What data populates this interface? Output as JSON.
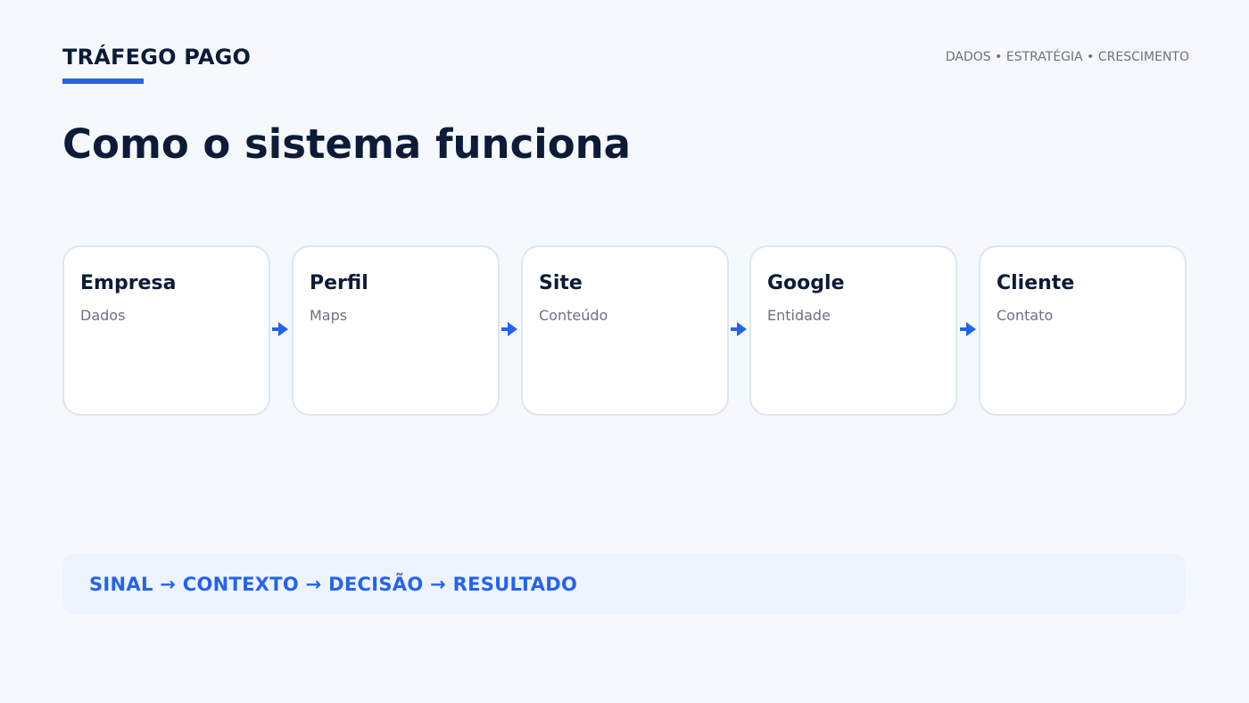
{
  "header": {
    "brand": "TRÁFEGO PAGO",
    "tagline": "DADOS • ESTRATÉGIA • CRESCIMENTO"
  },
  "title": "Como o sistema funciona",
  "flow": {
    "steps": [
      {
        "title": "Empresa",
        "subtitle": "Dados"
      },
      {
        "title": "Perfil",
        "subtitle": "Maps"
      },
      {
        "title": "Site",
        "subtitle": "Conteúdo"
      },
      {
        "title": "Google",
        "subtitle": "Entidade"
      },
      {
        "title": "Cliente",
        "subtitle": "Contato"
      }
    ],
    "connector_icon": "arrow-right-icon"
  },
  "footer": {
    "sequence": "SINAL → CONTEXTO → DECISÃO → RESULTADO"
  },
  "colors": {
    "accent": "#2563eb",
    "heading": "#0d1b38",
    "muted": "#6b7280",
    "background": "#f5f9fd",
    "card_border": "#dde6f0",
    "footer_background": "#edf4fe"
  }
}
